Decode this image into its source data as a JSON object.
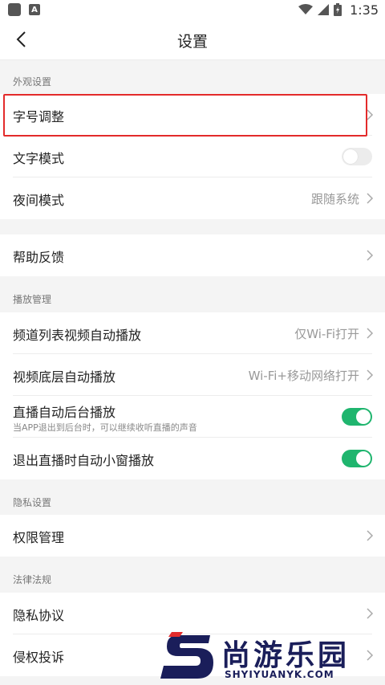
{
  "status_bar": {
    "time": "1:35",
    "left_icons": [
      "app-icon",
      "a-badge-icon"
    ],
    "right_icons": [
      "wifi-icon",
      "signal-icon",
      "battery-icon"
    ]
  },
  "nav": {
    "back_icon": "chevron-left-icon",
    "title": "设置"
  },
  "sections": {
    "appearance": {
      "header": "外观设置",
      "font_size": "字号调整",
      "text_mode": "文字模式",
      "text_mode_on": false,
      "night_mode": "夜间模式",
      "night_mode_value": "跟随系统"
    },
    "feedback": {
      "label": "帮助反馈"
    },
    "playback": {
      "header": "播放管理",
      "channel_autoplay": "频道列表视频自动播放",
      "channel_autoplay_value": "仅Wi-Fi打开",
      "bottom_autoplay": "视频底层自动播放",
      "bottom_autoplay_value": "Wi-Fi+移动网络打开",
      "live_background": "直播自动后台播放",
      "live_background_sub": "当APP退出到后台时，可以继续收听直播的声音",
      "live_background_on": true,
      "live_miniwindow": "退出直播时自动小窗播放",
      "live_miniwindow_on": true
    },
    "privacy": {
      "header": "隐私设置",
      "permissions": "权限管理"
    },
    "legal": {
      "header": "法律法规",
      "privacy_policy": "隐私协议",
      "infringement": "侵权投诉"
    }
  },
  "colors": {
    "accent_toggle": "#1fb56e",
    "highlight_border": "#e32b2b",
    "watermark": "#1a1e5a"
  },
  "watermark": {
    "text": "尚游乐园",
    "url": "SHYIYUANYK.COM"
  }
}
